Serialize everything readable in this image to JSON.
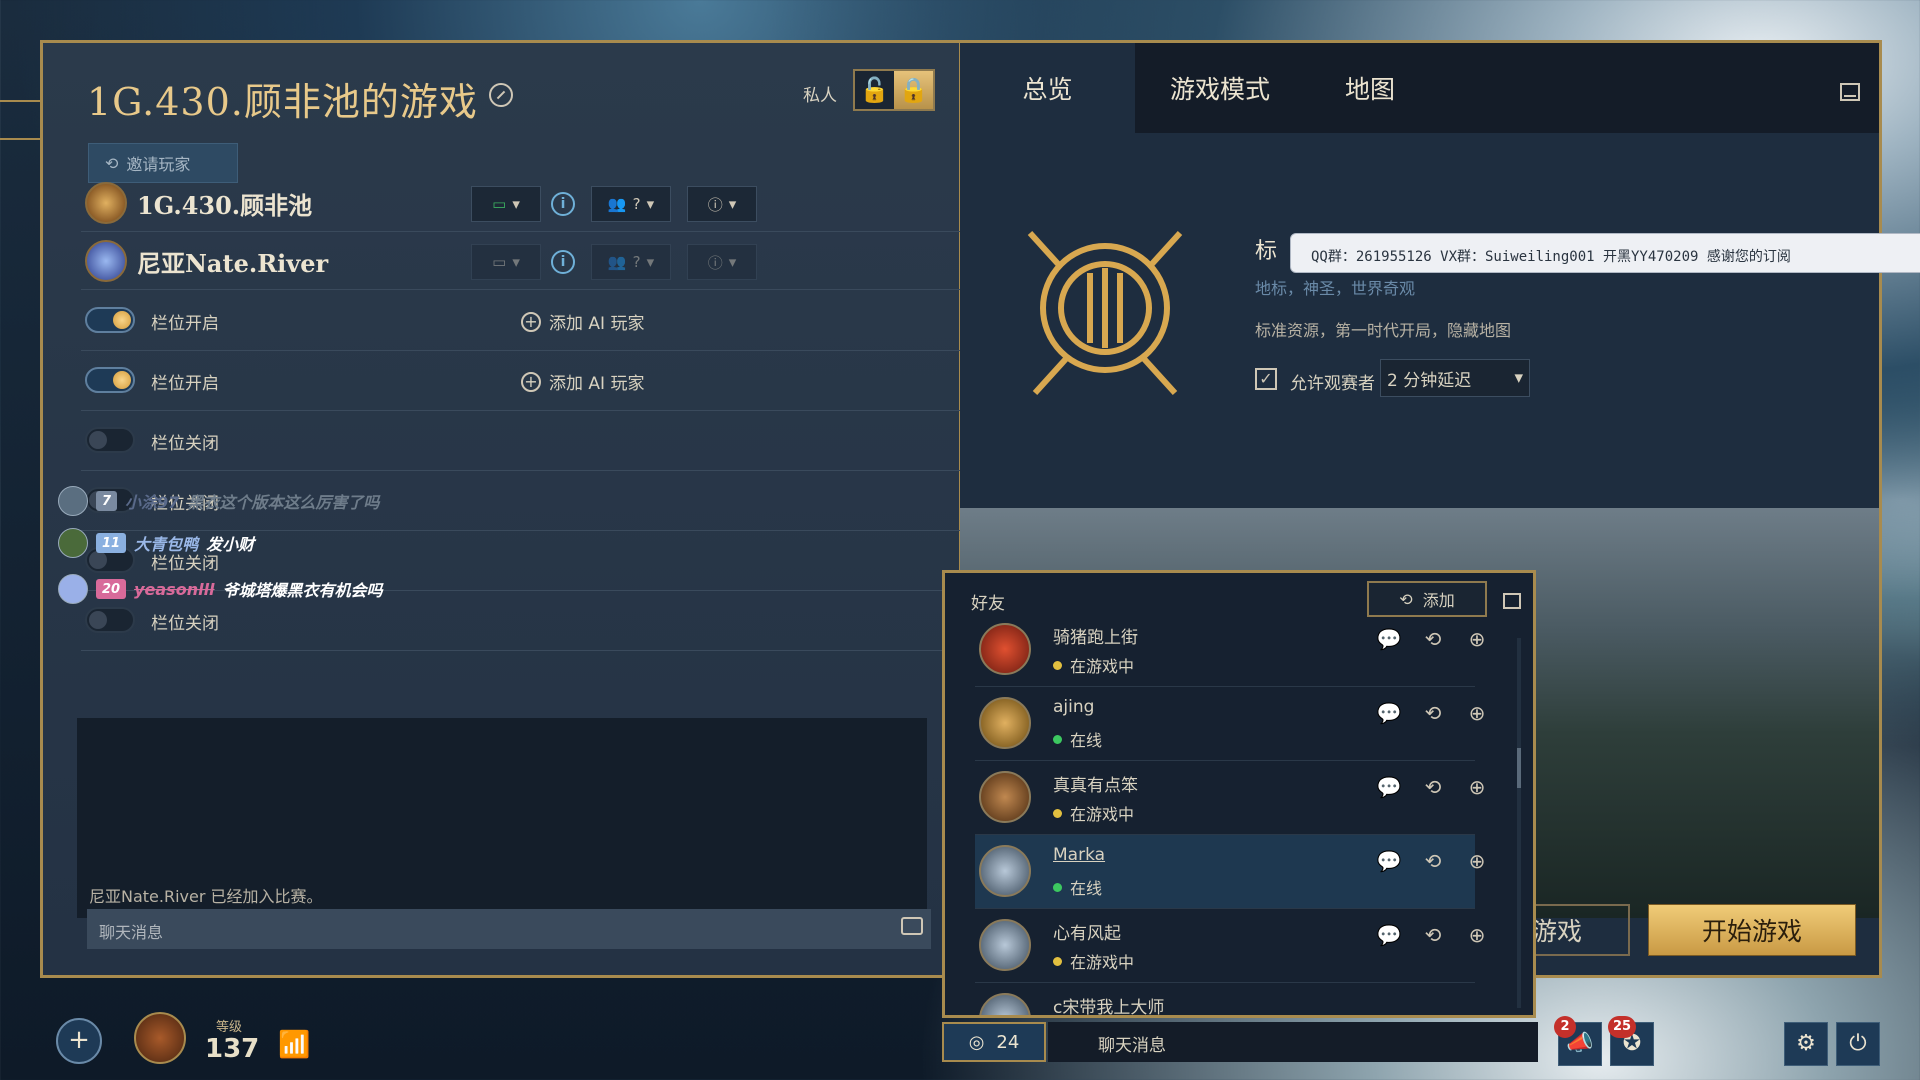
{
  "lobby": {
    "title": "1G.430.顾非池的游戏",
    "private_label": "私人",
    "invite_label": "邀请玩家",
    "players": [
      {
        "name": "1G.430.顾非池",
        "team": "?",
        "slot_icon": "question-icon"
      },
      {
        "name": "尼亚Nate.River",
        "team": "?",
        "slot_icon": "question-icon"
      }
    ],
    "slots": [
      {
        "label": "栏位开启",
        "state": "open",
        "action": "添加 AI 玩家"
      },
      {
        "label": "栏位开启",
        "state": "open",
        "action": "添加 AI 玩家"
      },
      {
        "label": "栏位关闭",
        "state": "closed"
      },
      {
        "label": "栏位关闭",
        "state": "closed"
      },
      {
        "label": "栏位关闭",
        "state": "closed"
      },
      {
        "label": "栏位关闭",
        "state": "closed"
      }
    ],
    "system_message": "尼亚Nate.River 已经加入比赛。",
    "chat_placeholder": "聊天消息"
  },
  "overlay_chat": [
    {
      "badge": "7",
      "user": "小涂97",
      "text": "黑衣这个版本这么厉害了吗"
    },
    {
      "badge": "11",
      "user": "大青包鸭",
      "text": "发小财"
    },
    {
      "badge": "20",
      "user": "yeasonlll",
      "text": "爷城塔爆黑衣有机会吗"
    }
  ],
  "right": {
    "tabs": [
      "总览",
      "游戏模式",
      "地图"
    ],
    "active_tab": "总览",
    "map_title_partial": "标",
    "map_subtitle": "地标，神圣，世界奇观",
    "map_settings": "标准资源，第一时代开局，隐藏地图",
    "allow_spectators": "允许观赛者",
    "spectator_checked": true,
    "delay": "2 分钟延迟",
    "other_button_partial": "游戏",
    "start_button": "开始游戏"
  },
  "tooltip": "QQ群：261955126 VX群：Suiweiling001 开黑YY470209 感谢您的订阅",
  "friends": {
    "title": "好友",
    "add_label": "添加",
    "list": [
      {
        "name": "骑猪跑上街",
        "status": "在游戏中",
        "status_color": "#e2c040"
      },
      {
        "name": "ajing",
        "status": "在线",
        "status_color": "#3cc860"
      },
      {
        "name": "真真有点笨",
        "status": "在游戏中",
        "status_color": "#e2c040"
      },
      {
        "name": "Marka",
        "status": "在线",
        "status_color": "#3cc860",
        "selected": true
      },
      {
        "name": "心有风起",
        "status": "在游戏中",
        "status_color": "#e2c040"
      },
      {
        "name": "c宋带我上大师",
        "status": "",
        "status_color": ""
      }
    ]
  },
  "bottom": {
    "level_label": "等级",
    "level": "137",
    "friends_online": "24",
    "chat_label": "聊天消息",
    "notif_a": "2",
    "notif_b": "25"
  },
  "colors": {
    "gold": "#a88b4e",
    "accent": "#e2c37d",
    "panel": "#243244",
    "online": "#3cc860",
    "ingame": "#e2c040"
  }
}
